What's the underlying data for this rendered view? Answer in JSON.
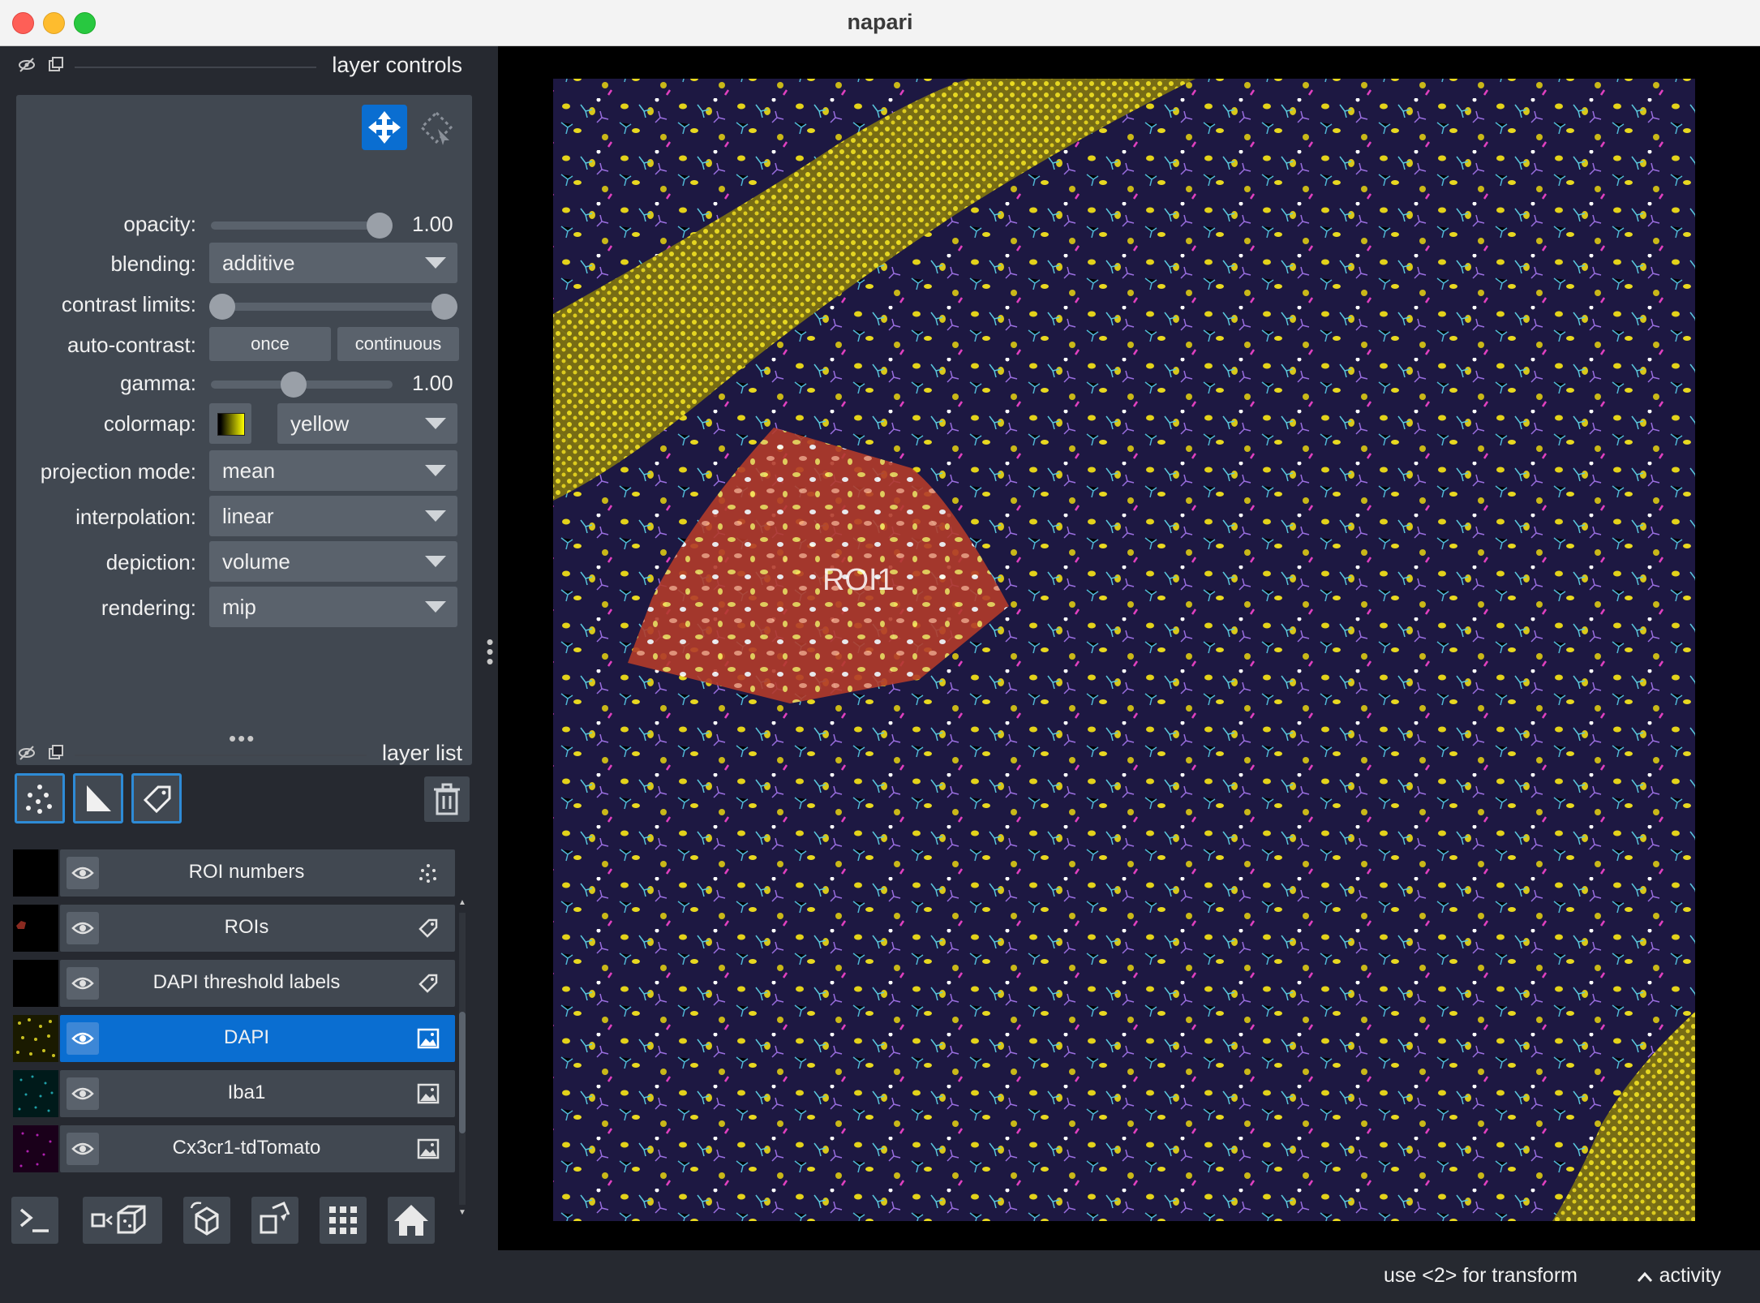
{
  "window": {
    "title": "napari"
  },
  "layer_controls": {
    "title": "layer controls",
    "opacity": {
      "label": "opacity:",
      "value": "1.00",
      "fraction": 1.0
    },
    "blending": {
      "label": "blending:",
      "value": "additive"
    },
    "contrast_limits": {
      "label": "contrast limits:",
      "low_fraction": 0.0,
      "high_fraction": 1.0
    },
    "auto_contrast": {
      "label": "auto-contrast:",
      "once": "once",
      "continuous": "continuous"
    },
    "gamma": {
      "label": "gamma:",
      "value": "1.00",
      "fraction": 0.45
    },
    "colormap": {
      "label": "colormap:",
      "value": "yellow"
    },
    "projection_mode": {
      "label": "projection mode:",
      "value": "mean"
    },
    "interpolation": {
      "label": "interpolation:",
      "value": "linear"
    },
    "depiction": {
      "label": "depiction:",
      "value": "volume"
    },
    "rendering": {
      "label": "rendering:",
      "value": "mip"
    }
  },
  "layer_list": {
    "title": "layer list",
    "layers": [
      {
        "name": "ROI numbers",
        "type_icon": "points-icon",
        "selected": false
      },
      {
        "name": "ROIs",
        "type_icon": "labels-icon",
        "selected": false
      },
      {
        "name": "DAPI threshold labels",
        "type_icon": "labels-icon",
        "selected": false
      },
      {
        "name": "DAPI",
        "type_icon": "image-icon",
        "selected": true
      },
      {
        "name": "Iba1",
        "type_icon": "image-icon",
        "selected": false
      },
      {
        "name": "Cx3cr1-tdTomato",
        "type_icon": "image-icon",
        "selected": false
      }
    ]
  },
  "canvas": {
    "roi_label": "ROI1"
  },
  "status": {
    "hint": "use <2> for transform",
    "activity": "activity"
  },
  "colors": {
    "accent": "#0a6ed1",
    "panel": "#414851",
    "background": "#262930",
    "roi": "#c0392b"
  }
}
